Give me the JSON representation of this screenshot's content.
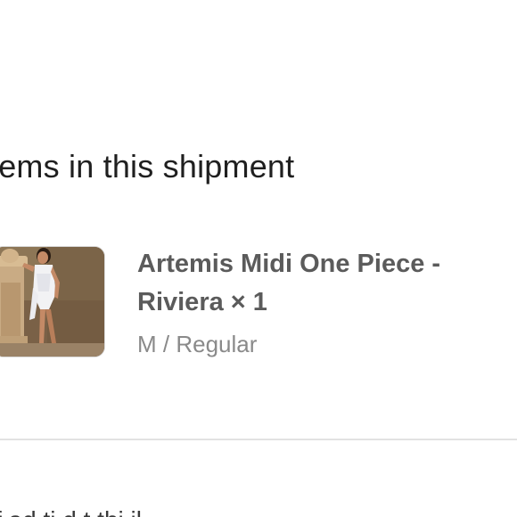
{
  "shipment": {
    "section_title": "tems in this shipment",
    "items": [
      {
        "name": "Artemis Midi One Piece - Riviera × 1",
        "variant": "M / Regular",
        "thumbnail_icon": "product-photo"
      }
    ]
  },
  "footer": {
    "cutoff_text": "f  ad                    ti         d t thi         il"
  },
  "colors": {
    "title": "#1f1f1f",
    "item_name": "#5b5b5b",
    "variant": "#8a8a8a",
    "divider": "#e2e2e2",
    "thumb_border": "#d9d9d9"
  }
}
